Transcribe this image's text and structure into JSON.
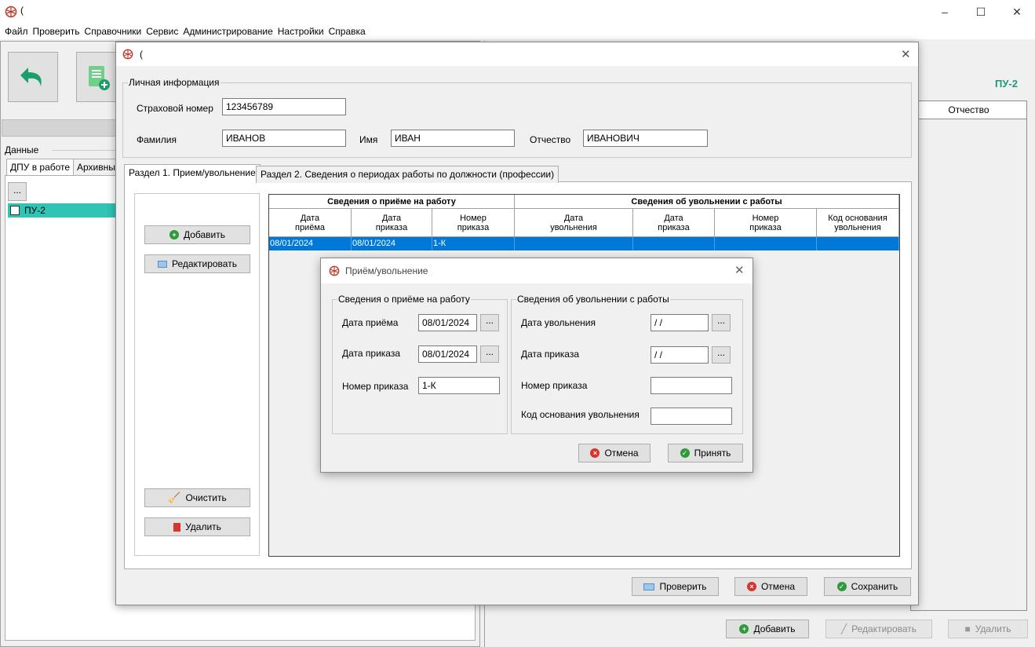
{
  "window": {
    "title_suffix": "(",
    "controls": {
      "minimize": "–",
      "maximize": "☐",
      "close": "✕"
    }
  },
  "menu": [
    "Файл",
    "Проверить",
    "Справочники",
    "Сервис",
    "Администрирование",
    "Настройки",
    "Справка"
  ],
  "background": {
    "data_group_label": "Данные",
    "tabs": [
      "ДПУ в работе",
      "Архивные"
    ],
    "ellipsis": "...",
    "row_label": "ПУ-2",
    "right_title": "ПУ-2",
    "right_column": "Отчество",
    "buttons": {
      "add": "Добавить",
      "edit": "Редактировать",
      "delete": "Удалить"
    }
  },
  "dialog1": {
    "title": "(",
    "personal_info": {
      "legend": "Личная информация",
      "insurance_label": "Страховой номер",
      "insurance_value": "123456789",
      "lastname_label": "Фамилия",
      "lastname_value": "ИВАНОВ",
      "firstname_label": "Имя",
      "firstname_value": "ИВАН",
      "patronymic_label": "Отчество",
      "patronymic_value": "ИВАНОВИЧ"
    },
    "tabs": [
      "Раздел 1. Прием/увольнение",
      "Раздел 2. Сведения о периодах работы по должности (профессии)"
    ],
    "side_buttons": {
      "add": "Добавить",
      "edit": "Редактировать",
      "clear": "Очистить",
      "delete": "Удалить"
    },
    "grid": {
      "group_hire": "Сведения о приёме на работу",
      "group_dismissal": "Сведения об увольнении с работы",
      "columns": [
        [
          "Дата",
          "приёма"
        ],
        [
          "Дата",
          "приказа"
        ],
        [
          "Номер",
          "приказа"
        ],
        [
          "Дата",
          "увольнения"
        ],
        [
          "Дата",
          "приказа"
        ],
        [
          "Номер",
          "приказа"
        ],
        [
          "Код основания",
          "увольнения"
        ]
      ],
      "rows": [
        [
          "08/01/2024",
          "08/01/2024",
          "1-К",
          "",
          "",
          "",
          ""
        ]
      ]
    },
    "bottom_buttons": {
      "check": "Проверить",
      "cancel": "Отмена",
      "save": "Сохранить"
    }
  },
  "dialog2": {
    "title": "Приём/увольнение",
    "hire_group": {
      "legend": "Сведения о приёме на работу",
      "hire_date_label": "Дата приёма",
      "hire_date_value": "08/01/2024",
      "order_date_label": "Дата приказа",
      "order_date_value": "08/01/2024",
      "order_no_label": "Номер приказа",
      "order_no_value": "1-К"
    },
    "dismissal_group": {
      "legend": "Сведения об увольнении с работы",
      "dismissal_date_label": "Дата увольнения",
      "dismissal_date_value": "/ /",
      "order_date_label": "Дата приказа",
      "order_date_value": "/ /",
      "order_no_label": "Номер приказа",
      "order_no_value": "",
      "reason_code_label": "Код основания увольнения",
      "reason_code_value": ""
    },
    "ellipsis": "...",
    "buttons": {
      "cancel": "Отмена",
      "accept": "Принять"
    }
  },
  "colors": {
    "accent_teal": "#2ec4b6",
    "selection_blue": "#0078d7",
    "brand_green": "#1a9a7c"
  }
}
